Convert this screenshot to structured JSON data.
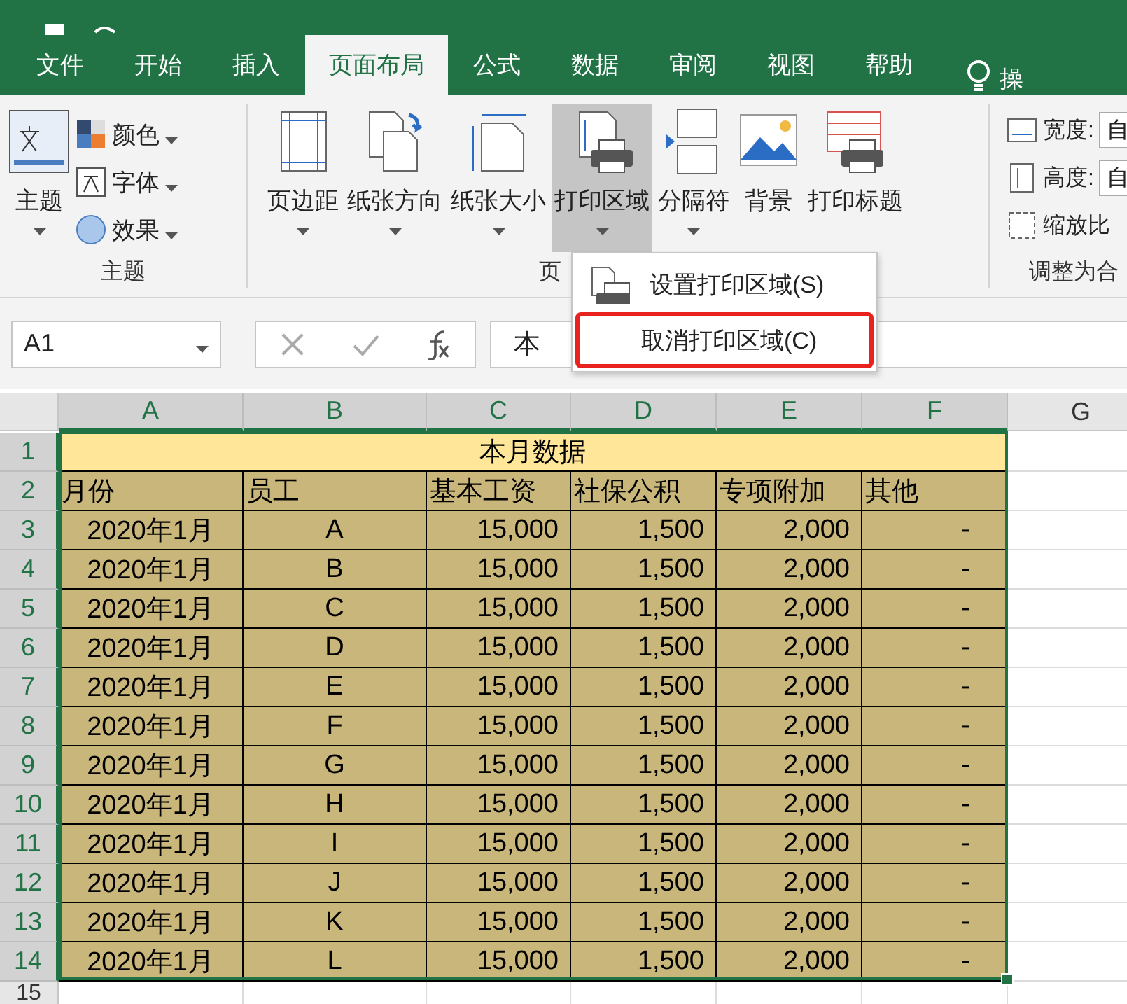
{
  "tabs": [
    {
      "label": "文件",
      "selected": false
    },
    {
      "label": "开始",
      "selected": false
    },
    {
      "label": "插入",
      "selected": false
    },
    {
      "label": "页面布局",
      "selected": true
    },
    {
      "label": "公式",
      "selected": false
    },
    {
      "label": "数据",
      "selected": false
    },
    {
      "label": "审阅",
      "selected": false
    },
    {
      "label": "视图",
      "selected": false
    },
    {
      "label": "帮助",
      "selected": false
    }
  ],
  "tell_me": "操",
  "ribbon": {
    "theme_group": {
      "label": "主题",
      "large_button": "主题",
      "small_buttons": [
        {
          "kind": "colors",
          "label": "颜色"
        },
        {
          "kind": "fonts",
          "label": "字体"
        },
        {
          "kind": "effects",
          "label": "效果"
        }
      ]
    },
    "page_setup_group": {
      "label": "页",
      "buttons": [
        {
          "kind": "margins",
          "label": "页边距",
          "has_menu": true,
          "selected": false
        },
        {
          "kind": "orientation",
          "label": "纸张方向",
          "has_menu": true,
          "selected": false
        },
        {
          "kind": "size",
          "label": "纸张大小",
          "has_menu": true,
          "selected": false
        },
        {
          "kind": "print_area",
          "label": "打印区域",
          "has_menu": true,
          "selected": true
        },
        {
          "kind": "breaks",
          "label": "分隔符",
          "has_menu": true,
          "selected": false
        },
        {
          "kind": "background",
          "label": "背景",
          "has_menu": false,
          "selected": false
        },
        {
          "kind": "print_titles",
          "label": "打印标题",
          "has_menu": false,
          "selected": false
        }
      ]
    },
    "scale_group": {
      "label": "调整为合",
      "rows": [
        {
          "kind": "width",
          "label": "宽度:",
          "value": "自"
        },
        {
          "kind": "height",
          "label": "高度:",
          "value": "自"
        }
      ],
      "scale_label": "缩放比"
    }
  },
  "menu": {
    "items": [
      {
        "label": "设置打印区域(S)",
        "icon": true,
        "selected": false
      },
      {
        "label": "取消打印区域(C)",
        "icon": false,
        "selected": true
      }
    ]
  },
  "name_box": "A1",
  "formula": "本",
  "sheet": {
    "columns": [
      {
        "label": "A",
        "selected": true
      },
      {
        "label": "B",
        "selected": true
      },
      {
        "label": "C",
        "selected": true
      },
      {
        "label": "D",
        "selected": true
      },
      {
        "label": "E",
        "selected": true
      },
      {
        "label": "F",
        "selected": true
      },
      {
        "label": "G",
        "selected": false
      }
    ],
    "title": "本月数据",
    "headers": [
      "月份",
      "员工",
      "基本工资",
      "社保公积",
      "专项附加",
      "其他"
    ],
    "rows": [
      [
        "2020年1月",
        "A",
        "15,000",
        "1,500",
        "2,000",
        "-"
      ],
      [
        "2020年1月",
        "B",
        "15,000",
        "1,500",
        "2,000",
        "-"
      ],
      [
        "2020年1月",
        "C",
        "15,000",
        "1,500",
        "2,000",
        "-"
      ],
      [
        "2020年1月",
        "D",
        "15,000",
        "1,500",
        "2,000",
        "-"
      ],
      [
        "2020年1月",
        "E",
        "15,000",
        "1,500",
        "2,000",
        "-"
      ],
      [
        "2020年1月",
        "F",
        "15,000",
        "1,500",
        "2,000",
        "-"
      ],
      [
        "2020年1月",
        "G",
        "15,000",
        "1,500",
        "2,000",
        "-"
      ],
      [
        "2020年1月",
        "H",
        "15,000",
        "1,500",
        "2,000",
        "-"
      ],
      [
        "2020年1月",
        "I",
        "15,000",
        "1,500",
        "2,000",
        "-"
      ],
      [
        "2020年1月",
        "J",
        "15,000",
        "1,500",
        "2,000",
        "-"
      ],
      [
        "2020年1月",
        "K",
        "15,000",
        "1,500",
        "2,000",
        "-"
      ],
      [
        "2020年1月",
        "L",
        "15,000",
        "1,500",
        "2,000",
        "-"
      ]
    ],
    "row_numbers": [
      "1",
      "2",
      "3",
      "4",
      "5",
      "6",
      "7",
      "8",
      "9",
      "10",
      "11",
      "12",
      "13",
      "14",
      "15"
    ]
  }
}
